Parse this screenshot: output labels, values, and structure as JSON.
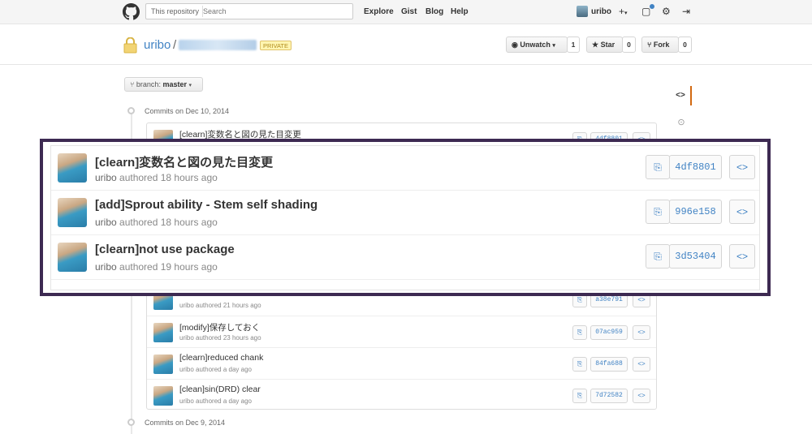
{
  "topbar": {
    "search_scope": "This repository",
    "search_placeholder": "Search",
    "nav": [
      "Explore",
      "Gist",
      "Blog",
      "Help"
    ],
    "username": "uribo"
  },
  "repo": {
    "owner": "uribo",
    "separator": "/",
    "visibility": "PRIVATE",
    "watch_label": "Unwatch",
    "watch_count": "1",
    "star_label": "Star",
    "star_count": "0",
    "fork_label": "Fork",
    "fork_count": "0"
  },
  "branch": {
    "prefix": "branch:",
    "name": "master"
  },
  "sidebar": {
    "code_icon": "code-icon",
    "issues_icon": "issue-icon"
  },
  "dates": {
    "first": "Commits on Dec 10, 2014",
    "second": "Commits on Dec 9, 2014"
  },
  "commits_background": [
    {
      "title": "[clearn]変数名と図の見た目変更",
      "author": "uribo",
      "meta": "authored 18 hours ago",
      "sha": "4df8801"
    },
    {
      "title": "",
      "author": "uribo",
      "meta": "authored 21 hours ago",
      "sha": "a38e791"
    },
    {
      "title": "[modify]保存しておく",
      "author": "uribo",
      "meta": "authored 23 hours ago",
      "sha": "07ac959"
    },
    {
      "title": "[clearn]reduced chank",
      "author": "uribo",
      "meta": "authored a day ago",
      "sha": "84fa688"
    },
    {
      "title": "[clean]sin(DRD) clear",
      "author": "uribo",
      "meta": "authored a day ago",
      "sha": "7d72582"
    }
  ],
  "commits_zoomed": [
    {
      "title": "[clearn]変数名と図の見た目変更",
      "author": "uribo",
      "meta": "authored 18 hours ago",
      "sha": "4df8801"
    },
    {
      "title": "[add]Sprout ability - Stem self shading",
      "author": "uribo",
      "meta": "authored 18 hours ago",
      "sha": "996e158"
    },
    {
      "title": "[clearn]not use package",
      "author": "uribo",
      "meta": "authored 19 hours ago",
      "sha": "3d53404"
    }
  ],
  "colors": {
    "accent": "#4183c4",
    "highlight_frame": "#3d2a52",
    "tab_active": "#d26911"
  }
}
